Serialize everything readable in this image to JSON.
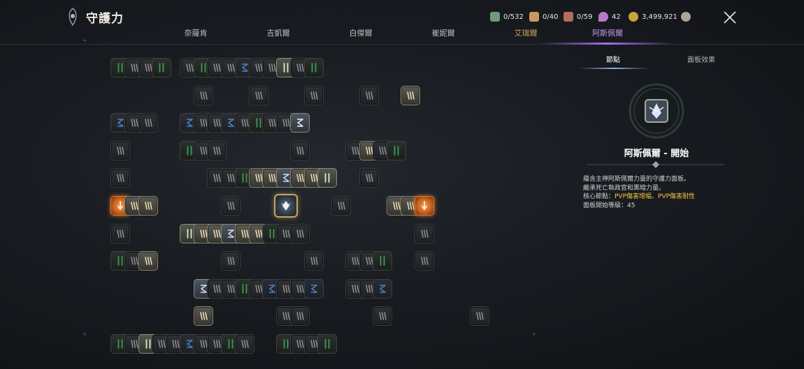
{
  "header": {
    "title": "守護力",
    "currencies": [
      {
        "icon": "cube-token-icon",
        "value": "0/532",
        "color": "#8fb89a"
      },
      {
        "icon": "scroll-token-icon",
        "value": "0/40",
        "color": "#d8b070"
      },
      {
        "icon": "book-token-icon",
        "value": "0/59",
        "color": "#c77a6a"
      },
      {
        "icon": "feather-crystal-icon",
        "value": "42",
        "color": "#c98ad8"
      },
      {
        "icon": "gold-coin-icon",
        "value": "3,499,921",
        "color": "#d9b548"
      },
      {
        "icon": "chat-bubble-icon",
        "value": "",
        "color": "#b9b4a6"
      }
    ]
  },
  "tabs": [
    {
      "label": "奈薩肯",
      "state": "normal"
    },
    {
      "label": "吉凱爾",
      "state": "normal"
    },
    {
      "label": "白傑爾",
      "state": "normal"
    },
    {
      "label": "崔妮爾",
      "state": "normal"
    },
    {
      "label": "艾瑞爾",
      "state": "gold"
    },
    {
      "label": "阿斯佩爾",
      "state": "active"
    }
  ],
  "grid_rows": [
    "G.D.D.G..D.G.D.D.B.D.D.N.D.G",
    "......D....D....D....D...U..",
    "B.D.D...B.D.D.B.D.G.D.D.C...",
    "D.....G.D.D......D....D.U.D.G",
    "D.......D.D.G.U.U.P.U.U.N...D",
    "O.U.U......D....X....D....U.U.O",
    "D.....N.U.U.P.U.U.G.D.D.........D",
    "G.D.U......D......D...D.D.G...D",
    "......P.D.D.G.D.B.D.D.B...D.D.B",
    "......U......D.D......D.......D",
    "G.D.N.D.D.B.D.D.G.D...G.D.D.G"
  ],
  "panel": {
    "tabs": [
      "節點",
      "面板效果"
    ],
    "active_tab": 0,
    "node_title": "阿斯佩爾 - 開始",
    "desc_line1": "蘊含主神阿斯佩爾力量的守護力面板。",
    "desc_line2": "繼承死亡執政官和黑暗力量。",
    "desc_core_prefix": "核心節點：",
    "core_nodes": [
      "PVP傷害增幅",
      "PVP傷害耐性"
    ],
    "core_sep": "、",
    "desc_level": "面板開始等級：45"
  },
  "colors": {
    "accent_purple": "#a66ef0",
    "highlight_yellow": "#f2c640",
    "gold_border": "#c6a65e"
  }
}
